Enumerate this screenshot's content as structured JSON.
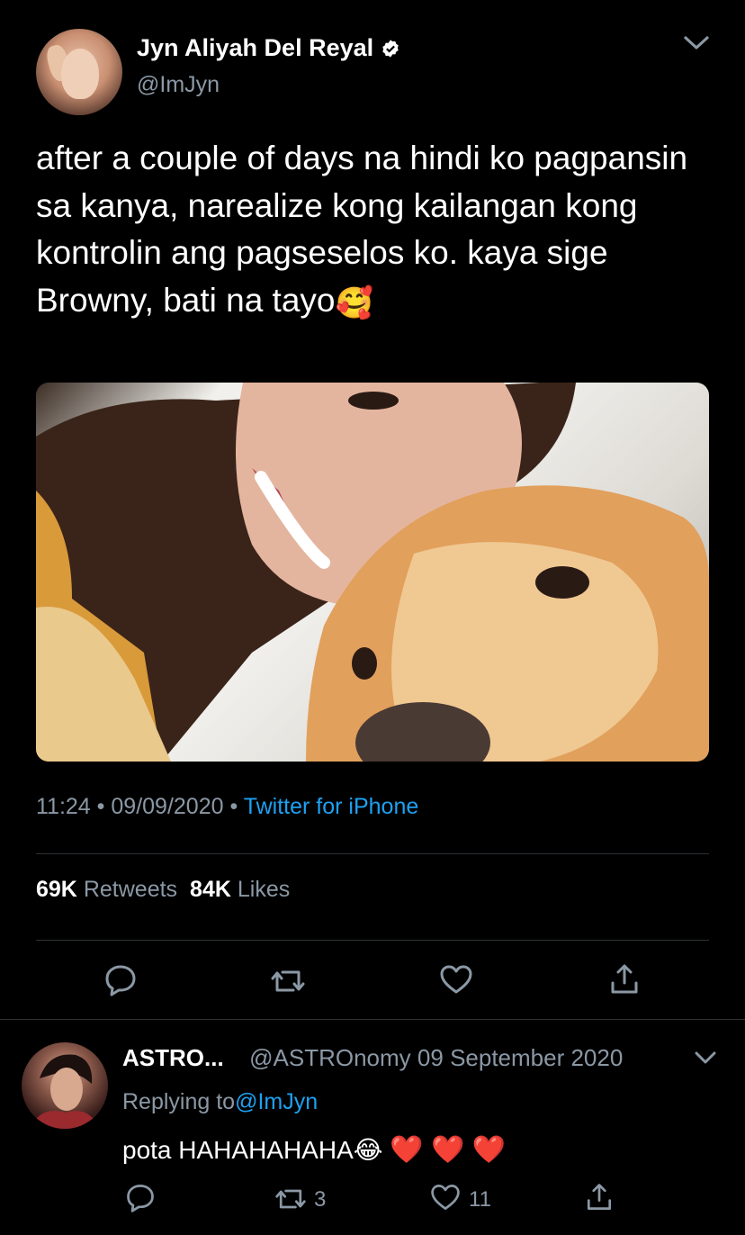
{
  "tweet": {
    "author_name": "Jyn Aliyah Del Reyal",
    "handle": "@ImJyn",
    "text_before_emoji": "after a couple of days na hindi ko pagpansin sa kanya, narealize kong kailangan kong kontrolin ang pagseselos ko. kaya sige Browny, bati na tayo",
    "emoji": "🥰",
    "time": "11:24",
    "date": "09/09/2020",
    "source": "Twitter for iPhone",
    "retweets_count": "69K",
    "retweets_label": "Retweets",
    "likes_count": "84K",
    "likes_label": "Likes"
  },
  "reply": {
    "author_name": "ASTRO...",
    "handle": "@ASTROnomy",
    "date": "09 September 2020",
    "replying_to_label": "Replying to",
    "replying_to_handle": "@ImJyn",
    "text": "pota HAHAHAHAHA",
    "emojis": "😂",
    "hearts": "❤️ ❤️ ❤️",
    "retweet_count": "3",
    "like_count": "11"
  },
  "icons": {
    "verified": "verified-badge-icon",
    "chevron": "chevron-down-icon",
    "reply": "reply-icon",
    "retweet": "retweet-icon",
    "like": "heart-icon",
    "share": "share-icon"
  },
  "colors": {
    "background": "#000000",
    "link": "#1da1f2",
    "secondary_text": "#8b98a5",
    "divider": "#2f3336"
  }
}
